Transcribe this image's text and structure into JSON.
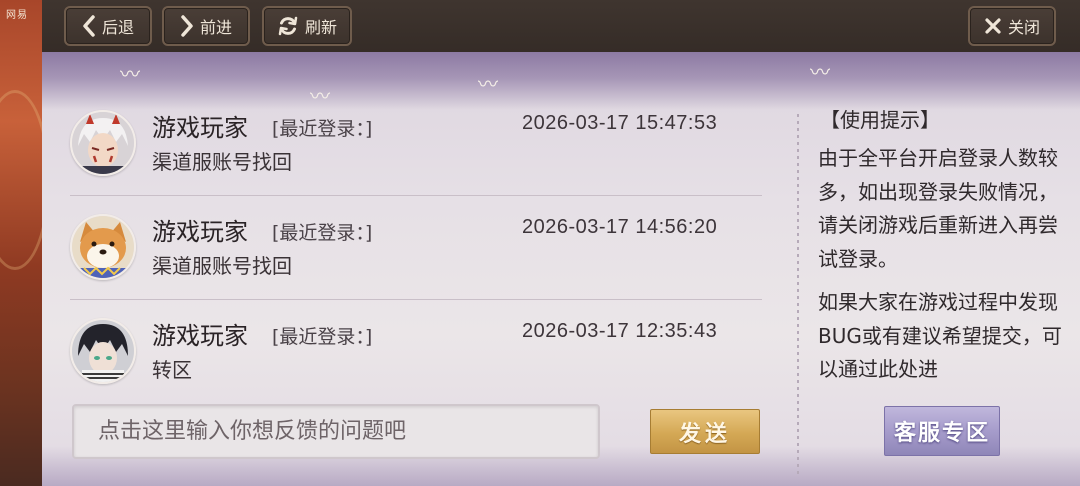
{
  "backdrop": {
    "label": "网易"
  },
  "toolbar": {
    "back_label": "后退",
    "forward_label": "前进",
    "refresh_label": "刷新",
    "close_label": "关闭"
  },
  "conversations": [
    {
      "name": "游戏玩家",
      "login_label": "[最近登录：]",
      "timestamp": "2026-03-17 15:47:53",
      "subject": "渠道服账号找回",
      "avatar": "white-hair-character-avatar"
    },
    {
      "name": "游戏玩家",
      "login_label": "[最近登录：]",
      "timestamp": "2026-03-17 14:56:20",
      "subject": "渠道服账号找回",
      "avatar": "shiba-dog-avatar"
    },
    {
      "name": "游戏玩家",
      "login_label": "[最近登录：]",
      "timestamp": "2026-03-17 12:35:43",
      "subject": "转区",
      "avatar": "dark-hair-character-avatar"
    }
  ],
  "input": {
    "placeholder": "点击这里输入你想反馈的问题吧"
  },
  "send_label": "发送",
  "tips": {
    "title": "【使用提示】",
    "para1": "由于全平台开启登录人数较多，如出现登录失败情况，请关闭游戏后重新进入再尝试登录。",
    "para2": "如果大家在游戏过程中发现BUG或有建议希望提交，可以通过此处进"
  },
  "service_label": "客服专区",
  "colors": {
    "accent_gold": "#d4a855",
    "accent_purple": "#a69ccb",
    "toolbar_bg": "#3f352f"
  }
}
